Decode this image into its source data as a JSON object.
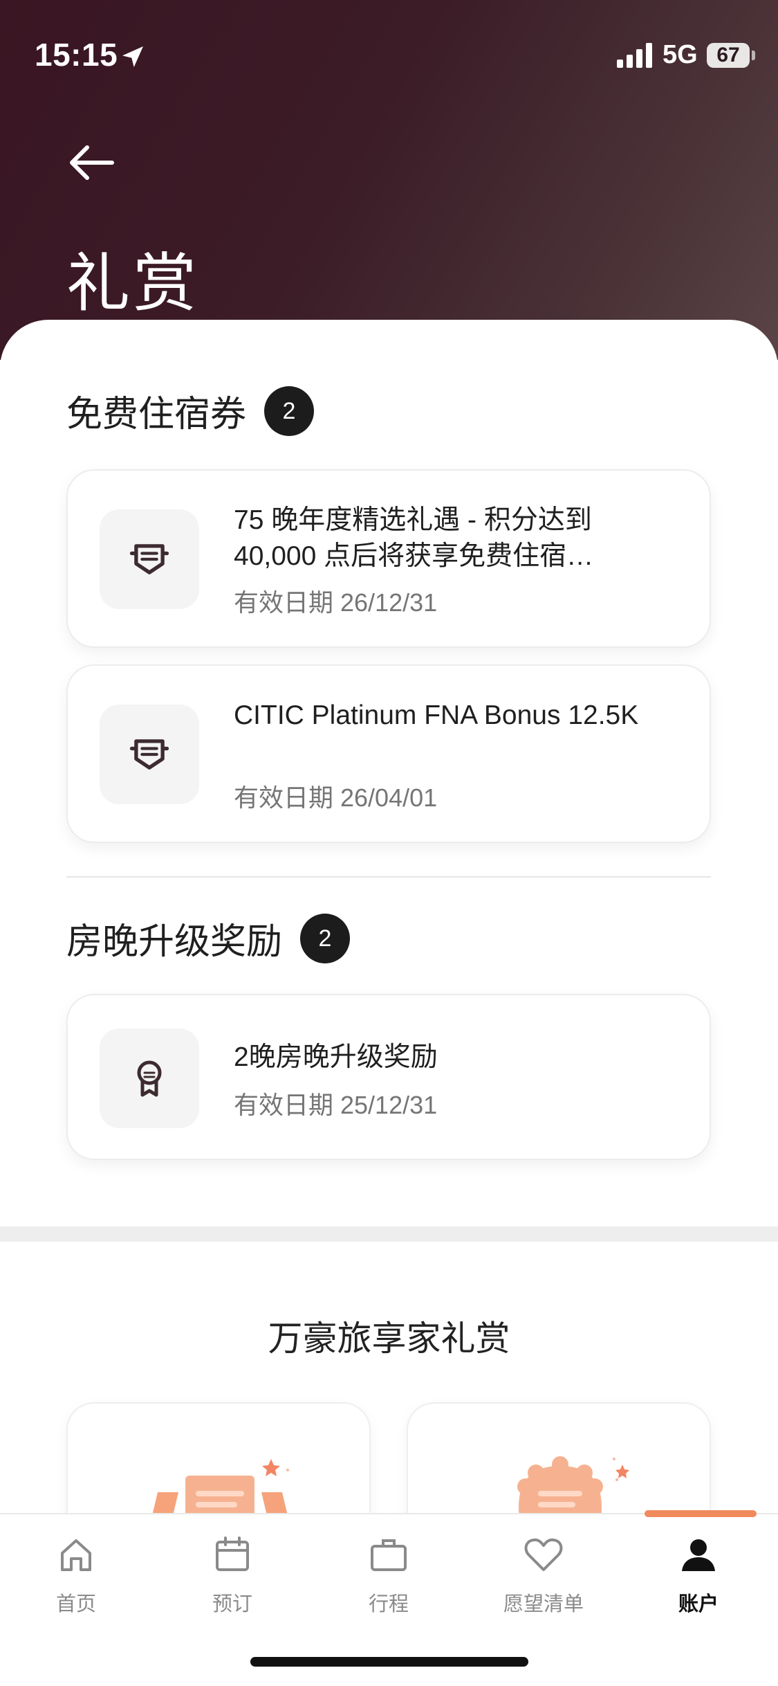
{
  "status_bar": {
    "time": "15:15",
    "network": "5G",
    "battery": "67"
  },
  "header": {
    "title": "礼赏",
    "back_icon": "arrow-left-icon"
  },
  "sections": {
    "free_nights": {
      "title": "免费住宿券",
      "count": "2",
      "items": [
        {
          "title": "75 晚年度精选礼遇 - 积分达到 40,000 点后将获享免费住宿…",
          "date": "有效日期 26/12/31",
          "icon": "voucher-badge-icon"
        },
        {
          "title": "CITIC Platinum FNA Bonus 12.5K",
          "date": "有效日期 26/04/01",
          "icon": "voucher-badge-icon"
        }
      ]
    },
    "upgrades": {
      "title": "房晚升级奖励",
      "count": "2",
      "items": [
        {
          "title": "2晚房晚升级奖励",
          "date": "有效日期 25/12/31",
          "icon": "award-ribbon-icon"
        }
      ]
    }
  },
  "promo": {
    "title": "万豪旅享家礼赏"
  },
  "tab_bar": {
    "tabs": [
      {
        "label": "首页",
        "icon": "home-icon"
      },
      {
        "label": "预订",
        "icon": "calendar-icon"
      },
      {
        "label": "行程",
        "icon": "briefcase-icon"
      },
      {
        "label": "愿望清单",
        "icon": "heart-icon"
      },
      {
        "label": "账户",
        "icon": "account-icon"
      }
    ],
    "active": "账户"
  },
  "colors": {
    "header_dark": "#3a1523",
    "accent_orange": "#f08a5d",
    "badge": "#1c1c1c"
  }
}
